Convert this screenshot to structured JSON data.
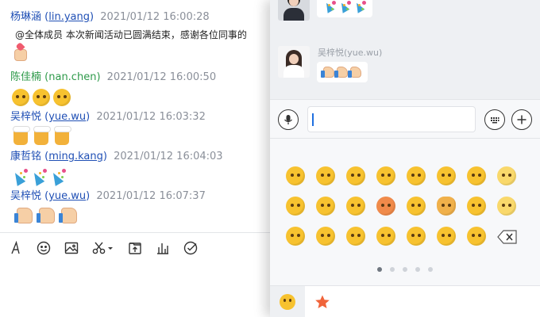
{
  "chat": {
    "messages": [
      {
        "sender": "杨琳涵",
        "handle": "lin.yang",
        "time": "2021/01/12 16:00:28",
        "text": "@全体成员 本次新闻活动已圆满结束，感谢各位同事的",
        "emojis": [
          "hand-heart"
        ]
      },
      {
        "sender": "陈佳楠",
        "handle": "nan.chen",
        "time": "2021/01/12 16:00:50",
        "text": "",
        "emojis": [
          "blush",
          "blush",
          "blush"
        ]
      },
      {
        "sender": "吴梓悦",
        "handle": "yue.wu",
        "time": "2021/01/12 16:03:32",
        "text": "",
        "emojis": [
          "beer",
          "beer",
          "beer"
        ]
      },
      {
        "sender": "康哲铭",
        "handle": "ming.kang",
        "time": "2021/01/12 16:04:03",
        "text": "",
        "emojis": [
          "party-popper",
          "party-popper",
          "party-popper"
        ]
      },
      {
        "sender": "吴梓悦",
        "handle": "yue.wu",
        "time": "2021/01/12 16:07:37",
        "text": "",
        "emojis": [
          "thumbs-up",
          "thumbs-up",
          "thumbs-up"
        ]
      }
    ]
  },
  "toolbar": {
    "items": [
      "font-icon",
      "emoji-icon",
      "image-icon",
      "scissors-icon",
      "file-upload-icon",
      "chart-icon",
      "check-icon"
    ]
  },
  "phone": {
    "messages": [
      {
        "name": "",
        "avatar": "man",
        "emojis": [
          "party-popper",
          "party-popper",
          "party-popper"
        ]
      },
      {
        "name": "吴梓悦(yue.wu)",
        "avatar": "woman",
        "emojis": [
          "thumbs-up",
          "thumbs-up",
          "thumbs-up"
        ]
      }
    ],
    "input": {
      "value": "",
      "placeholder": ""
    },
    "emoji_grid": [
      [
        "sob",
        "laugh-tears",
        "grin",
        "angry-smirk",
        "wink-tongue",
        "cover-mouth",
        "party-face",
        "nerd"
      ],
      [
        "dizzy",
        "facepalm",
        "salute",
        "red-face",
        "sunglasses-1",
        "shiba-dog",
        "sunglasses-2",
        "smile"
      ],
      [
        "heart-eyes",
        "shock",
        "cry-glasses",
        "crying",
        "red-cheek",
        "xx-face",
        "sweat",
        "delete-key"
      ]
    ],
    "page_indicator": {
      "total": 5,
      "current": 1
    },
    "tabs": [
      "smile-tab-icon",
      "star-tab-icon"
    ]
  },
  "colors": {
    "link": "#1f4fb5",
    "green_sender": "#2e9a4a",
    "star": "#f0643a",
    "emoji": "#f7c22f"
  }
}
